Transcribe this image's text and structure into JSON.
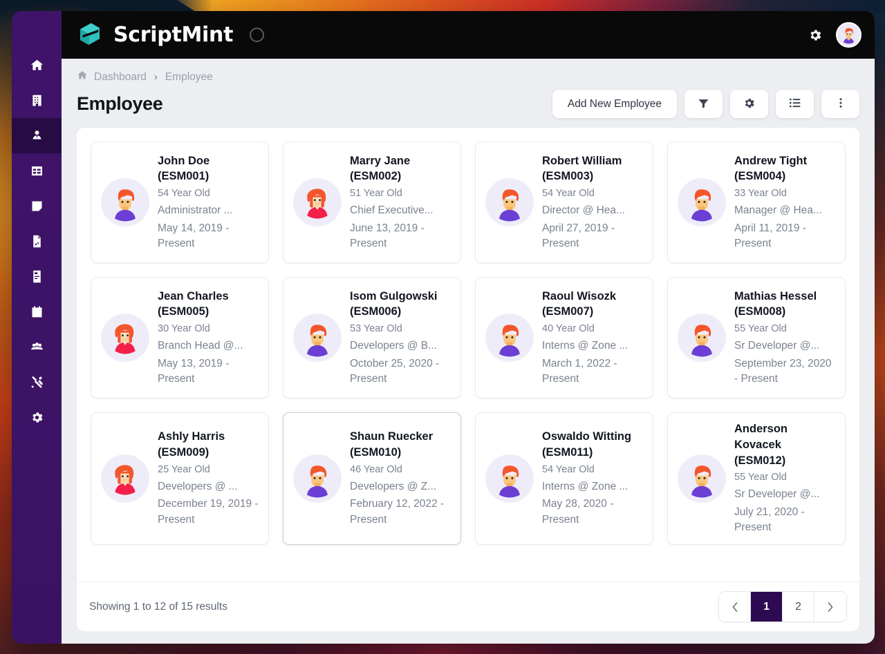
{
  "header": {
    "brand": "ScriptMint",
    "logo_icon": "scriptmint-logo",
    "loading_icon": "spinner-circle",
    "settings_icon": "gear-icon",
    "avatar_icon": "user-avatar"
  },
  "sidebar": {
    "items": [
      {
        "name": "home",
        "icon": "home-icon",
        "active": false
      },
      {
        "name": "company",
        "icon": "building-icon",
        "active": false
      },
      {
        "name": "employee",
        "icon": "user-tie-icon",
        "active": true
      },
      {
        "name": "dashboard-grid",
        "icon": "table-icon",
        "active": false
      },
      {
        "name": "notes",
        "icon": "sticky-note-icon",
        "active": false
      },
      {
        "name": "reports",
        "icon": "file-chart-icon",
        "active": false
      },
      {
        "name": "documents",
        "icon": "file-invoice-icon",
        "active": false
      },
      {
        "name": "calendar",
        "icon": "calendar-icon",
        "active": false
      },
      {
        "name": "teams",
        "icon": "users-icon",
        "active": false
      },
      {
        "name": "tools",
        "icon": "tools-icon",
        "active": false
      },
      {
        "name": "settings",
        "icon": "cog-icon",
        "active": false
      }
    ]
  },
  "breadcrumb": {
    "home_icon": "home-icon",
    "items": [
      "Dashboard",
      "Employee"
    ],
    "separator": "›"
  },
  "page": {
    "title": "Employee"
  },
  "toolbar": {
    "add_label": "Add New Employee",
    "filter_icon": "filter-icon",
    "settings_icon": "gear-icon",
    "list_icon": "list-view-icon",
    "more_icon": "vertical-dots-icon"
  },
  "employees": [
    {
      "name": "John Doe (ESM001)",
      "age": "54 Year Old",
      "role": "Administrator ...",
      "period": "May 14, 2019 - Present",
      "gender": "male",
      "highlight": false
    },
    {
      "name": "Marry Jane (ESM002)",
      "age": "51 Year Old",
      "role": "Chief Executive...",
      "period": "June 13, 2019 - Present",
      "gender": "female",
      "highlight": false
    },
    {
      "name": "Robert William (ESM003)",
      "age": "54 Year Old",
      "role": "Director @ Hea...",
      "period": "April 27, 2019 - Present",
      "gender": "male",
      "highlight": false
    },
    {
      "name": "Andrew Tight (ESM004)",
      "age": "33 Year Old",
      "role": "Manager @ Hea...",
      "period": "April 11, 2019 - Present",
      "gender": "male",
      "highlight": false
    },
    {
      "name": "Jean Charles (ESM005)",
      "age": "30 Year Old",
      "role": "Branch Head @...",
      "period": "May 13, 2019 - Present",
      "gender": "female",
      "highlight": false
    },
    {
      "name": "Isom Gulgowski (ESM006)",
      "age": "53 Year Old",
      "role": "Developers @ B...",
      "period": "October 25, 2020 - Present",
      "gender": "male",
      "highlight": false
    },
    {
      "name": "Raoul Wisozk (ESM007)",
      "age": "40 Year Old",
      "role": "Interns @ Zone ...",
      "period": "March 1, 2022 - Present",
      "gender": "male",
      "highlight": false
    },
    {
      "name": "Mathias Hessel (ESM008)",
      "age": "55 Year Old",
      "role": "Sr Developer @...",
      "period": "September 23, 2020 - Present",
      "gender": "male",
      "highlight": false
    },
    {
      "name": "Ashly Harris (ESM009)",
      "age": "25 Year Old",
      "role": "Developers @ ...",
      "period": "December 19, 2019 - Present",
      "gender": "female",
      "highlight": false
    },
    {
      "name": "Shaun Ruecker (ESM010)",
      "age": "46 Year Old",
      "role": "Developers @ Z...",
      "period": "February 12, 2022 - Present",
      "gender": "male",
      "highlight": true
    },
    {
      "name": "Oswaldo Witting (ESM011)",
      "age": "54 Year Old",
      "role": "Interns @ Zone ...",
      "period": "May 28, 2020 - Present",
      "gender": "male",
      "highlight": false
    },
    {
      "name": "Anderson Kovacek (ESM012)",
      "age": "55 Year Old",
      "role": "Sr Developer @...",
      "period": "July 21, 2020 - Present",
      "gender": "male",
      "highlight": false
    }
  ],
  "footer": {
    "showing": "Showing 1 to 12 of 15 results",
    "prev_icon": "chevron-left-icon",
    "next_icon": "chevron-right-icon",
    "pages": [
      "1",
      "2"
    ],
    "active_page": "1"
  },
  "colors": {
    "sidebar": "#3d1466",
    "sidebar_active": "#280b45",
    "header": "#090909",
    "body_bg": "#eceef1",
    "brand_teal": "#2ec5c0",
    "pager_active": "#2d0a52"
  }
}
